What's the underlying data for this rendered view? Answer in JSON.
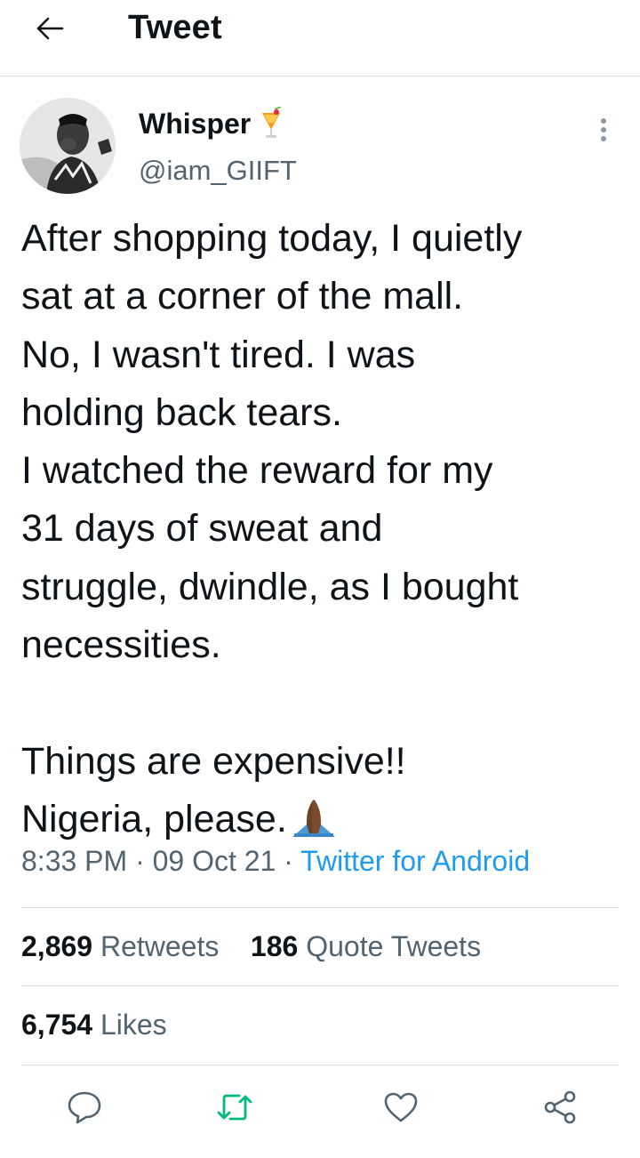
{
  "header": {
    "title": "Tweet",
    "back_icon": "arrow-left-icon"
  },
  "author": {
    "display_name": "Whisper",
    "name_emoji": "tropical-drink-icon",
    "handle": "@iam_GIIFT",
    "more_icon": "more-vertical-icon"
  },
  "tweet": {
    "lines": [
      "After shopping today, I quietly",
      "sat at a corner of the mall.",
      "No, I wasn't tired. I was",
      "holding back tears.",
      "I watched the reward for my",
      "31 days of sweat and",
      "struggle, dwindle, as I bought",
      "necessities.",
      "",
      "Things are expensive!!",
      "Nigeria, please."
    ],
    "end_emoji": "folded-hands-icon"
  },
  "meta": {
    "time": "8:33 PM",
    "separator": "·",
    "date": "09 Oct 21",
    "source": "Twitter for Android"
  },
  "stats": {
    "retweets_count": "2,869",
    "retweets_label": "Retweets",
    "quotes_count": "186",
    "quotes_label": "Quote Tweets",
    "likes_count": "6,754",
    "likes_label": "Likes"
  },
  "actions": {
    "reply_icon": "reply-icon",
    "retweet_icon": "retweet-icon",
    "like_icon": "heart-icon",
    "share_icon": "share-icon",
    "retweet_color": "#00ba7c"
  },
  "colors": {
    "text": "#0f1419",
    "secondary": "#536471",
    "accent": "#1d9bf0",
    "divider": "#dcdcdc"
  }
}
